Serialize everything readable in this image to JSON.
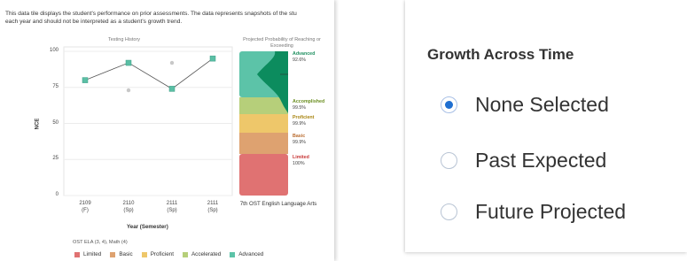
{
  "tile": {
    "description": "This data tile displays the student's performance on prior assessments. The data represents snapshots of the stu",
    "description_line2": "each year and should not be interpreted as a student's growth trend."
  },
  "chart_data": {
    "type": "line",
    "title": "Testing History",
    "ylabel": "NCE",
    "xlabel": "Year (Semester)",
    "ylim": [
      0,
      100
    ],
    "y_ticks": [
      "100",
      "75",
      "50",
      "25",
      "0"
    ],
    "categories": [
      {
        "year": "2109",
        "semester": "(F)"
      },
      {
        "year": "2110",
        "semester": "(Sp)"
      },
      {
        "year": "2111",
        "semester": "(Sp)"
      },
      {
        "year": "2111",
        "semester": "(Sp)"
      }
    ],
    "series": [
      {
        "values": [
          80,
          92,
          74,
          95
        ],
        "marker": "square",
        "color": "#5bbfa5"
      },
      {
        "values": [
          null,
          73,
          92,
          null
        ],
        "marker": "circle",
        "color": "#c8c8c8"
      }
    ],
    "grid": true
  },
  "projection": {
    "title": "Projected Probability of Reaching or Exceeding",
    "subject": "7th OST English Language Arts",
    "levels": [
      {
        "name": "Advanced",
        "percent": "92.6%",
        "color": "#5cc3a8",
        "text_color": "#1e8f5f"
      },
      {
        "name": "Accomplished",
        "percent": "99.5%",
        "color": "#b6cf7a",
        "text_color": "#6a8e1f"
      },
      {
        "name": "Proficient",
        "percent": "99.9%",
        "color": "#eec76a",
        "text_color": "#a88410"
      },
      {
        "name": "Basic",
        "percent": "99.9%",
        "color": "#dea270",
        "text_color": "#b86a2c"
      },
      {
        "name": "Limited",
        "percent": "100%",
        "color": "#e07272",
        "text_color": "#c83838"
      }
    ]
  },
  "legend": {
    "note": "OST ELA (3, 4), Math (4)",
    "items": [
      {
        "label": "Limited",
        "color": "#e07272"
      },
      {
        "label": "Basic",
        "color": "#dea270"
      },
      {
        "label": "Proficient",
        "color": "#eec76a"
      },
      {
        "label": "Accelerated",
        "color": "#b6cf7a"
      },
      {
        "label": "Advanced",
        "color": "#5cc3a8"
      }
    ]
  },
  "growth": {
    "title": "Growth Across Time",
    "options": [
      {
        "label": "None Selected",
        "selected": true
      },
      {
        "label": "Past Expected",
        "selected": false
      },
      {
        "label": "Future Projected",
        "selected": false
      }
    ]
  }
}
